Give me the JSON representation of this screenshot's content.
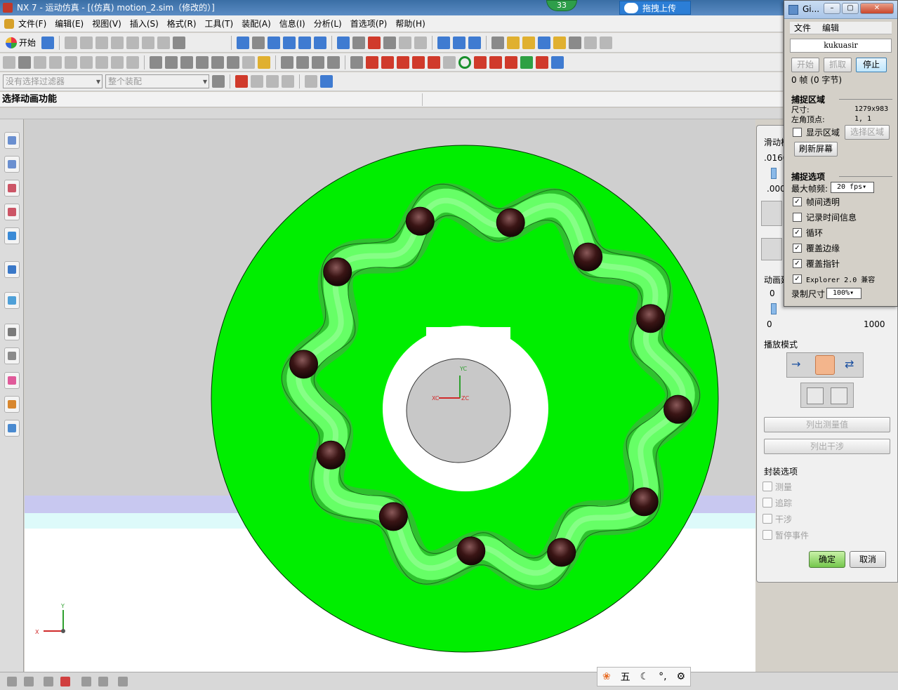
{
  "window": {
    "title": "NX 7 - 运动仿真 - [(仿真) motion_2.sim（修改的）]",
    "badge": "33",
    "upload_label": "拖拽上传"
  },
  "menu": [
    "文件(F)",
    "编辑(E)",
    "视图(V)",
    "插入(S)",
    "格式(R)",
    "工具(T)",
    "装配(A)",
    "信息(I)",
    "分析(L)",
    "首选项(P)",
    "帮助(H)"
  ],
  "toolbar": {
    "start_label": "开始",
    "filter_placeholder": "没有选择过滤器",
    "scope_placeholder": "整个装配"
  },
  "status": {
    "prompt": "选择动画功能"
  },
  "viewport": {
    "triad_labels": {
      "x": "X",
      "y": "Y"
    },
    "wcs_labels": {
      "xc": "XC",
      "yc": "YC",
      "zc": "ZC"
    },
    "colors": {
      "disk": "#00ee00",
      "track": "#66ff66",
      "track_shade": "#33cc33",
      "ball": "#3a1515",
      "hub": "#c8c8c8"
    }
  },
  "motion_panel": {
    "slider_label": "滑动模",
    "slider_value": ".0160",
    "slider_min": ".000",
    "anim_label": "动画延",
    "delay_value": "0",
    "delay_min": "0",
    "delay_max": "1000",
    "playback_mode_label": "播放模式",
    "list_measure": "列出测量值",
    "list_interference": "列出干涉",
    "envelope_label": "封装选项",
    "options": [
      "测量",
      "追踪",
      "干涉",
      "暂停事件"
    ],
    "ok": "确定",
    "cancel": "取消"
  },
  "gifcam": {
    "title": "Gi...",
    "menu": [
      "文件",
      "编辑"
    ],
    "user": "kukuasir",
    "buttons": {
      "start": "开始",
      "capture": "抓取",
      "stop": "停止"
    },
    "frames": "0 帧 (0 字节)",
    "capture_area": {
      "label": "捕捉区域",
      "size_label": "尺寸:",
      "size_value": "1279x983",
      "origin_label": "左角顶点:",
      "origin_value": "1, 1",
      "show_area": "显示区域",
      "select_area": "选择区域",
      "refresh": "刷新屏幕"
    },
    "capture_options": {
      "label": "捕捉选项",
      "fps_label": "最大帧频:",
      "fps_value": "20 fps",
      "items": [
        {
          "label": "帧间透明",
          "checked": true
        },
        {
          "label": "记录时间信息",
          "checked": false
        },
        {
          "label": "循环",
          "checked": true
        },
        {
          "label": "覆盖边缘",
          "checked": true
        },
        {
          "label": "覆盖指针",
          "checked": true
        },
        {
          "label": "Explorer 2.0 兼容",
          "checked": true
        }
      ],
      "record_size_label": "录制尺寸",
      "record_size_value": "100%"
    }
  },
  "ime": {
    "mode_char": "五"
  }
}
